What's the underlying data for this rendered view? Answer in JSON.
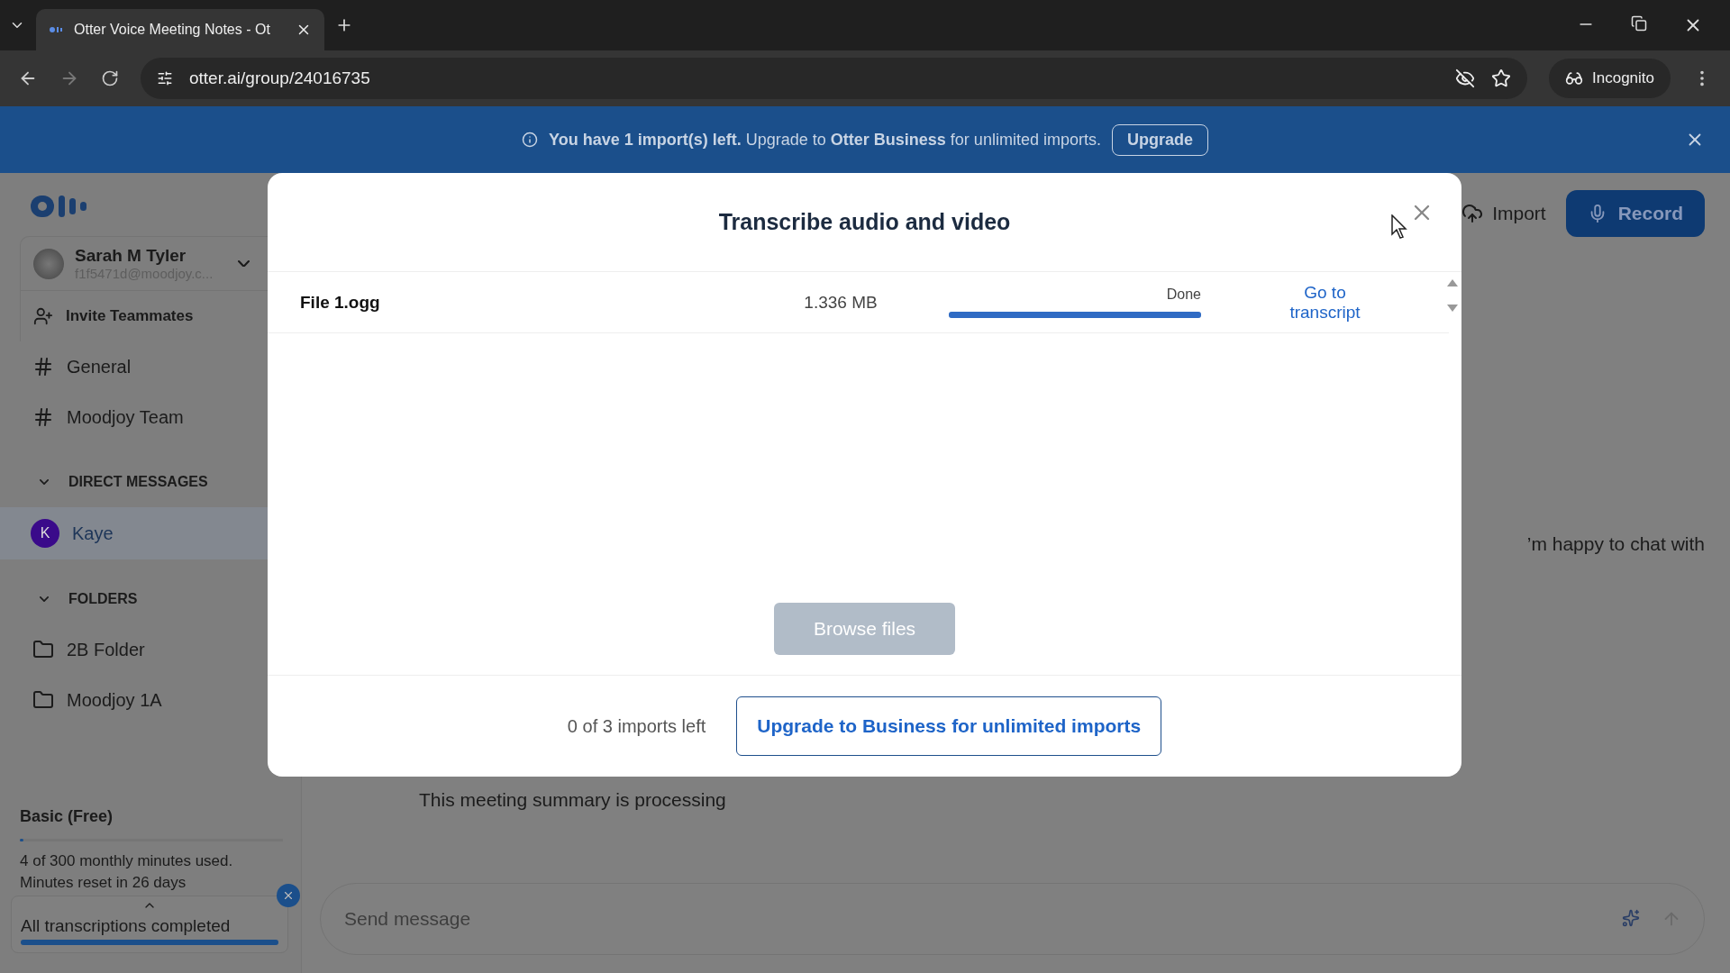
{
  "browser": {
    "tab_title": "Otter Voice Meeting Notes - Ot",
    "url": "otter.ai/group/24016735",
    "incognito": "Incognito"
  },
  "banner": {
    "text": "**You have 1 import(s) left.** Upgrade to **Otter Business** for unlimited imports.",
    "button": "Upgrade"
  },
  "sidebar": {
    "user": {
      "name": "Sarah M Tyler",
      "email": "f1f5471d@moodjoy.c..."
    },
    "invite": "Invite Teammates",
    "channels": [
      {
        "name": "General"
      },
      {
        "name": "Moodjoy Team"
      }
    ],
    "direct_messages": {
      "title": "DIRECT MESSAGES",
      "expanded": true,
      "items": [
        {
          "initial": "K",
          "name": "Kaye",
          "selected": true
        }
      ]
    },
    "folders": {
      "title": "FOLDERS",
      "expanded": true,
      "items": [
        {
          "name": "2B Folder"
        },
        {
          "name": "Moodjoy 1A"
        }
      ]
    },
    "plan": {
      "name": "Basic (Free)",
      "level": 0.013,
      "usage": "4 of 300 monthly minutes used.",
      "reset": "Minutes reset in 26 days"
    },
    "toast": {
      "text": "All transcriptions completed",
      "level": 1
    }
  },
  "header": {
    "import": "Import",
    "record": "Record"
  },
  "chat": {
    "snippet": "’m happy to chat with",
    "processing": "This meeting summary is processing",
    "placeholder": "Send message"
  },
  "modal": {
    "title": "Transcribe audio and video",
    "files": [
      {
        "name": "File 1.ogg",
        "size": "1.336 MB",
        "status": "Done",
        "level": 1,
        "link": "Go to transcript"
      }
    ],
    "browse": {
      "label": "Browse files",
      "disabled": true
    },
    "imports_left": "0 of 3 imports left",
    "upgrade": "Upgrade to Business for unlimited imports"
  }
}
